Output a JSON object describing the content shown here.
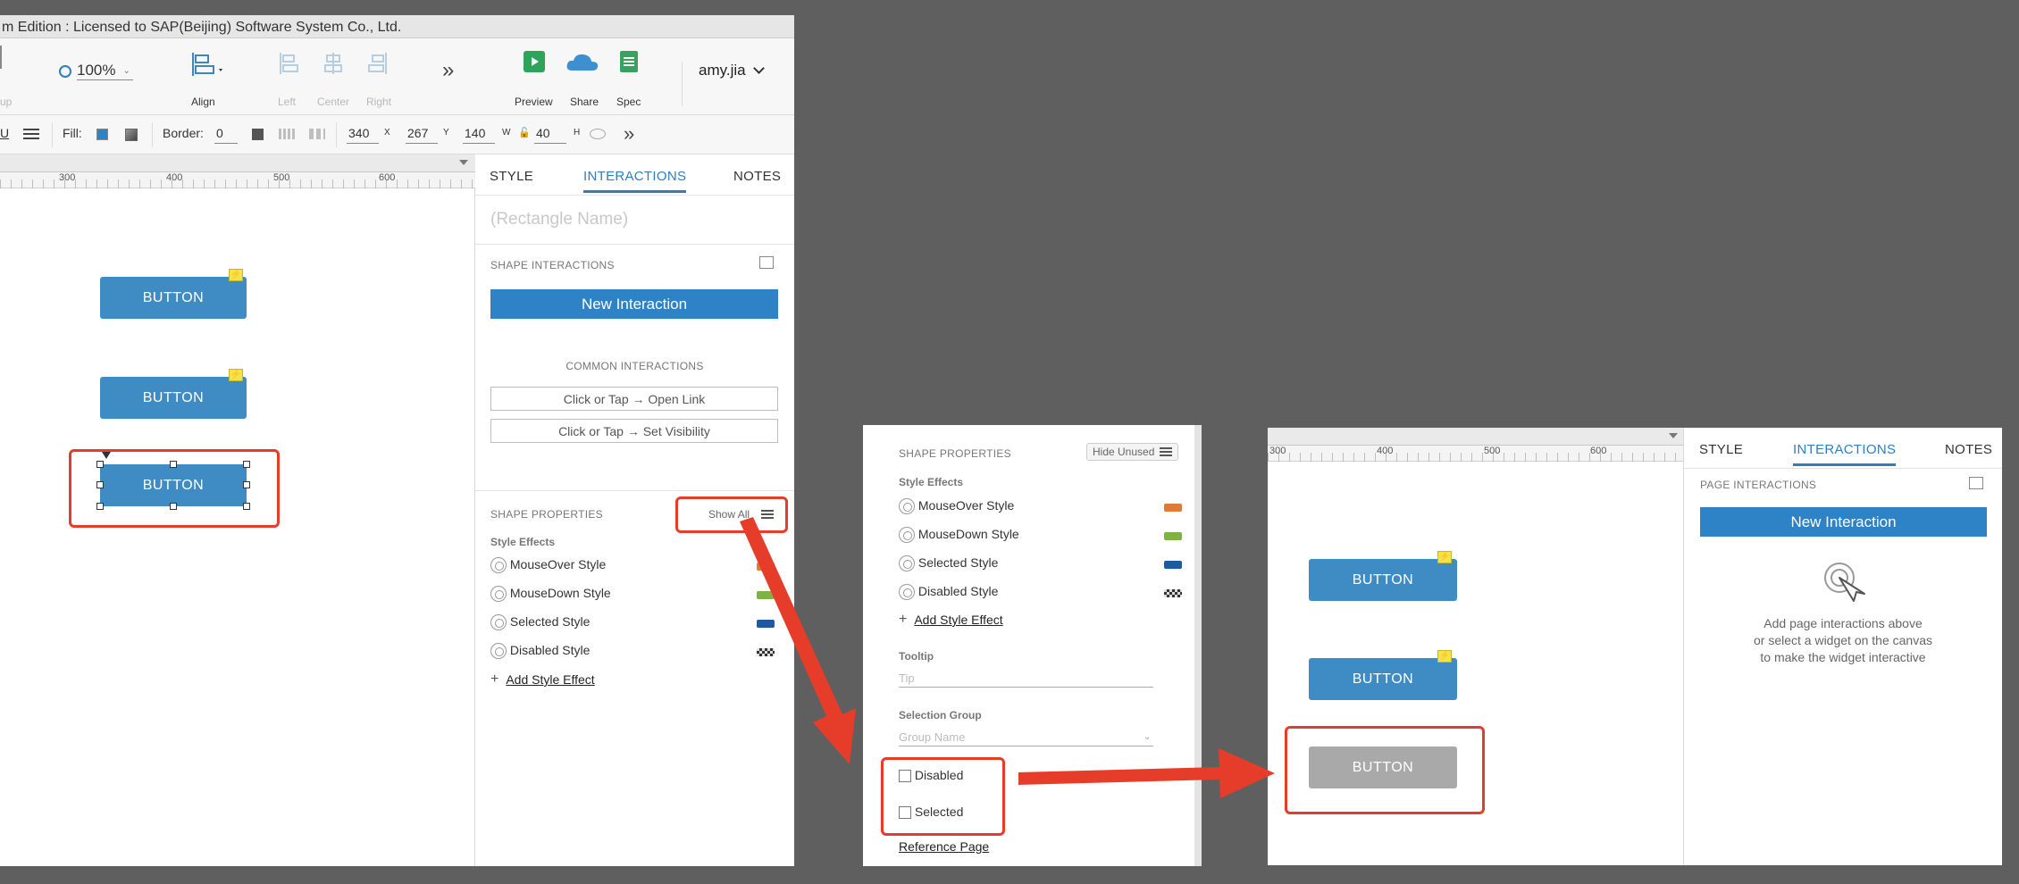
{
  "window": {
    "title": "m Edition : Licensed to SAP(Beijing) Software System Co., Ltd."
  },
  "toolbar": {
    "group_label": "up",
    "zoom_value": "100%",
    "align_label": "Align",
    "left_label": "Left",
    "center_label": "Center",
    "right_label": "Right",
    "more_glyph": "»",
    "preview_label": "Preview",
    "share_label": "Share",
    "spec_label": "Spec",
    "user_name": "amy.jia"
  },
  "formatbar": {
    "underline": "U",
    "fill_label": "Fill:",
    "border_label": "Border:",
    "border_value": "0",
    "x_value": "340",
    "x_unit": "X",
    "y_value": "267",
    "y_unit": "Y",
    "w_value": "140",
    "w_unit": "W",
    "h_value": "40",
    "h_unit": "H",
    "more_glyph": "»"
  },
  "canvas": {
    "ruler_ticks": [
      "300",
      "400",
      "500",
      "600"
    ],
    "button_label": "BUTTON",
    "bolt_glyph": "⚡"
  },
  "inspector": {
    "tabs": [
      "STYLE",
      "INTERACTIONS",
      "NOTES"
    ],
    "name_placeholder": "(Rectangle Name)",
    "shape_interactions_title": "SHAPE INTERACTIONS",
    "new_interaction_label": "New Interaction",
    "common_interactions_title": "COMMON INTERACTIONS",
    "common_interactions": [
      "Click or Tap → Open Link",
      "Click or Tap → Set Visibility"
    ],
    "shape_properties_title": "SHAPE PROPERTIES",
    "show_all_label": "Show All",
    "style_effects_title": "Style Effects",
    "style_effects": [
      {
        "label": "MouseOver Style",
        "color": "#e07b37"
      },
      {
        "label": "MouseDown Style",
        "color": "#7cb342"
      },
      {
        "label": "Selected Style",
        "color": "#1e5aa0"
      },
      {
        "label": "Disabled Style",
        "color": "checker"
      }
    ],
    "add_style_effect": "Add Style Effect"
  },
  "panel2": {
    "shape_properties_title": "SHAPE PROPERTIES",
    "hide_unused_label": "Hide Unused",
    "style_effects_title": "Style Effects",
    "style_effects": [
      {
        "label": "MouseOver Style",
        "color": "#e07b37"
      },
      {
        "label": "MouseDown Style",
        "color": "#7cb342"
      },
      {
        "label": "Selected Style",
        "color": "#1e5aa0"
      },
      {
        "label": "Disabled Style",
        "color": "checker"
      }
    ],
    "add_style_effect": "Add Style Effect",
    "tooltip_label": "Tooltip",
    "tooltip_placeholder": "Tip",
    "selection_group_label": "Selection Group",
    "group_name_placeholder": "Group Name",
    "disabled_label": "Disabled",
    "selected_label": "Selected",
    "reference_page_label": "Reference Page"
  },
  "panel3": {
    "ruler_ticks": [
      "300",
      "400",
      "500",
      "600"
    ],
    "button_label": "BUTTON",
    "tabs": [
      "STYLE",
      "INTERACTIONS",
      "NOTES"
    ],
    "page_interactions_title": "PAGE INTERACTIONS",
    "new_interaction_label": "New Interaction",
    "empty_text_1": "Add page interactions above",
    "empty_text_2": "or select a widget on the canvas",
    "empty_text_3": "to make the widget interactive"
  },
  "colors": {
    "accent": "#2e82c6",
    "button_fill": "#3f8cc4",
    "disabled_fill": "#a9a9a9",
    "highlight_red": "#e53d29",
    "background": "#5f5f5f"
  }
}
